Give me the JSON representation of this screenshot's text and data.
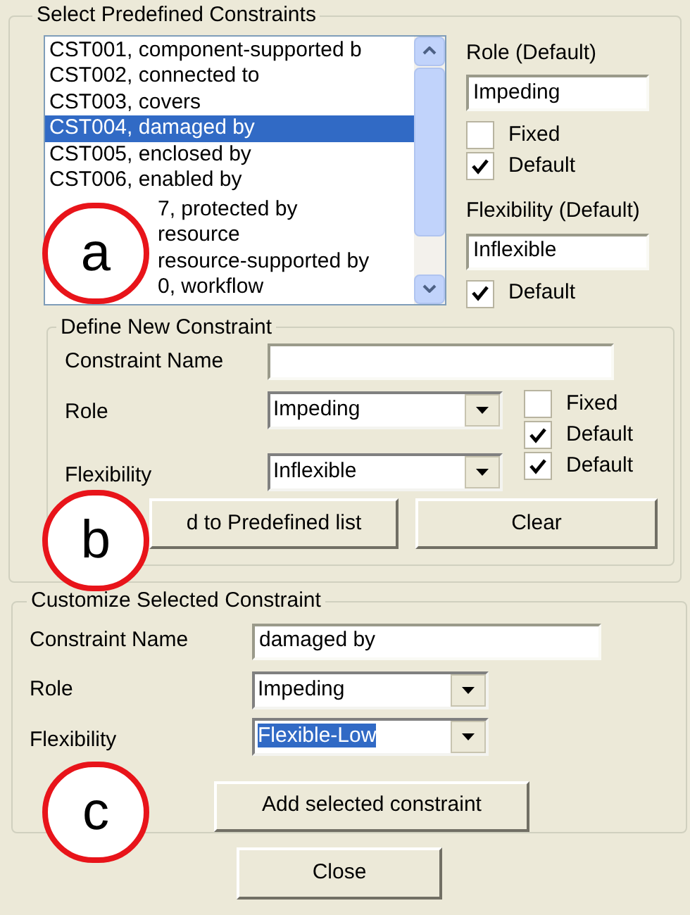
{
  "predefined": {
    "title": "Select Predefined Constraints",
    "items": [
      {
        "text": "CST001, component-supported b",
        "selected": false,
        "kind": "full"
      },
      {
        "text": "CST002, connected to",
        "selected": false,
        "kind": "full"
      },
      {
        "text": "CST003, covers",
        "selected": false,
        "kind": "full"
      },
      {
        "text": "CST004, damaged by",
        "selected": true,
        "kind": "full"
      },
      {
        "text": "CST005, enclosed by",
        "selected": false,
        "kind": "full"
      },
      {
        "text": "CST006, enabled by",
        "selected": false,
        "kind": "full"
      },
      {
        "text": "7, protected by",
        "selected": false,
        "kind": "partial"
      },
      {
        "text": "resource",
        "selected": false,
        "kind": "partial"
      },
      {
        "text": "resource-supported by",
        "selected": false,
        "kind": "partial"
      },
      {
        "text": "0, workflow",
        "selected": false,
        "kind": "partial"
      }
    ],
    "role_label": "Role (Default)",
    "role_value": "Impeding",
    "fixed": {
      "label": "Fixed",
      "checked": false
    },
    "role_default": {
      "label": "Default",
      "checked": true
    },
    "flex_label": "Flexibility (Default)",
    "flex_value": "Inflexible",
    "flex_default": {
      "label": "Default",
      "checked": true
    }
  },
  "define_new": {
    "title": "Define New Constraint",
    "name_label": "Constraint Name",
    "role_label": "Role",
    "role_value": "Impeding",
    "fixed": {
      "label": "Fixed",
      "checked": false
    },
    "role_default": {
      "label": "Default",
      "checked": true
    },
    "flex_label": "Flexibility",
    "flex_value": "Inflexible",
    "flex_default": {
      "label": "Default",
      "checked": true
    },
    "buttons": [
      "d to Predefined list",
      "Clear"
    ]
  },
  "customize": {
    "title": "Customize Selected Constraint",
    "name_label": "Constraint Name",
    "name_value": "damaged by",
    "role_label": "Role",
    "role_value": "Impeding",
    "flex_label": "Flexibility",
    "flex_value": "Flexible-Low",
    "flex_value_highlighted": true,
    "button": "Add selected constraint"
  },
  "close_button": "Close",
  "callouts": [
    "a",
    "b",
    "c"
  ]
}
